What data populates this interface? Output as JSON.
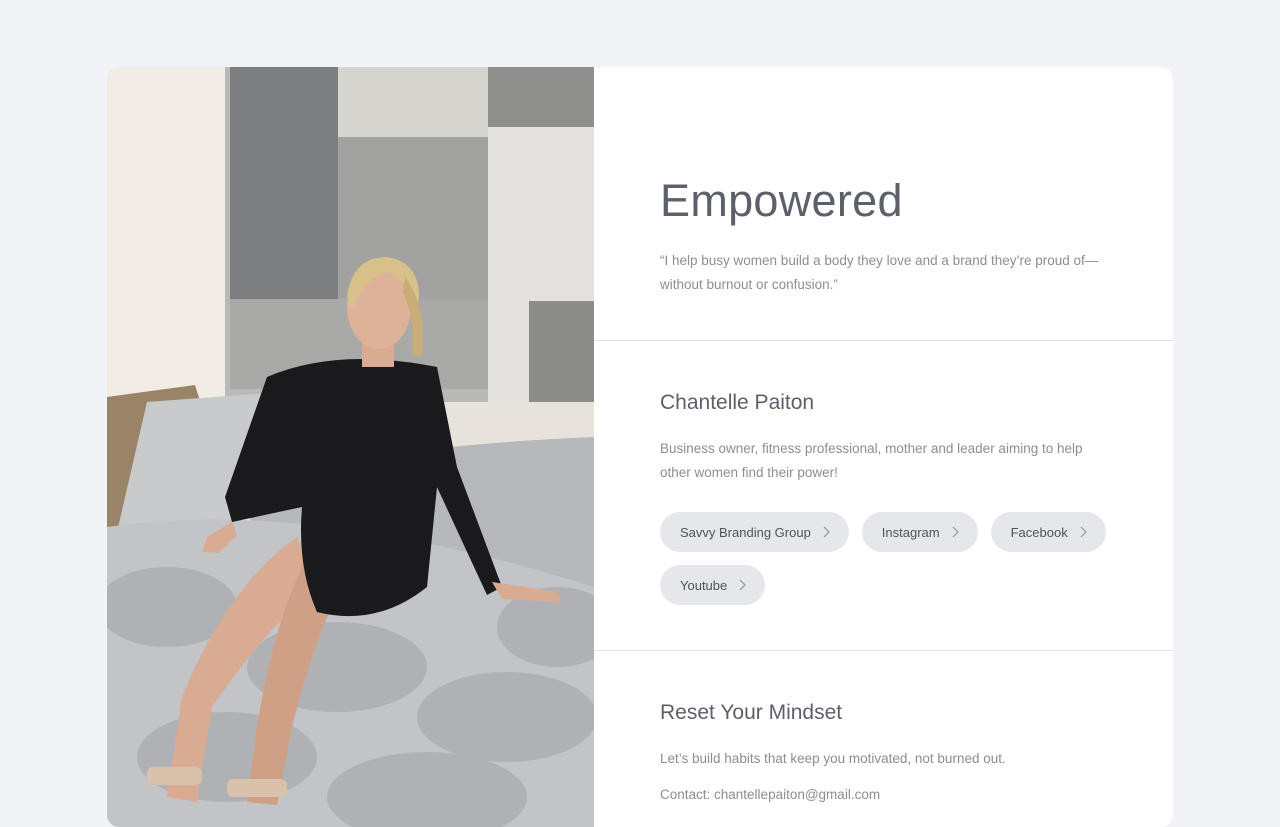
{
  "profile": {
    "photo_alt": "Woman in black dress sitting on grey sofa",
    "hero_title": "Empowered",
    "quote": "“I help busy women build a body they love and a brand they’re proud of—without burnout or confusion.”",
    "name": "Chantelle Paiton",
    "bio": "Business owner, fitness professional, mother and leader aiming to help other women find their power!",
    "links": [
      {
        "label": "Savvy Branding Group"
      },
      {
        "label": "Instagram"
      },
      {
        "label": "Facebook"
      },
      {
        "label": "Youtube"
      }
    ]
  },
  "mindset": {
    "title": "Reset Your Mindset",
    "text": "Let’s build habits that keep you motivated, not burned out.",
    "contact": "Contact: chantellepaiton@gmail.com"
  },
  "colors": {
    "page_bg": "#f2f3f7",
    "card_bg": "#ffffff",
    "chip_bg": "#e6e7ea",
    "heading": "#5c606b",
    "body_text": "#8b8e96"
  }
}
